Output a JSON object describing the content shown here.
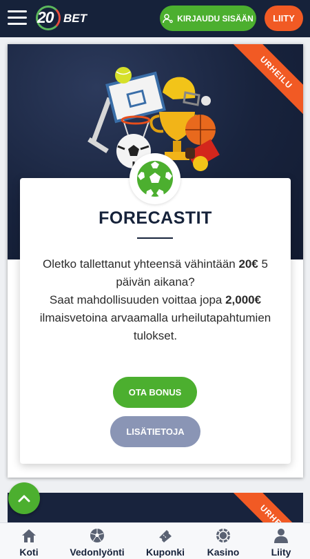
{
  "header": {
    "logo_number": "20",
    "logo_text": "BET",
    "login_label": "KIRJAUDU SISÄÄN",
    "join_label": "LIITY"
  },
  "promo": {
    "ribbon": "URHEILU",
    "title": "FORECASTIT",
    "desc_1": "Oletko tallettanut yhteensä vähintään ",
    "desc_amount": "20€",
    "desc_2": " 5 päivän aikana?",
    "desc_3": "Saat mahdollisuuden voittaa jopa ",
    "desc_prize": "2,000€",
    "desc_4": " ilmaisvetoina arvaamalla urheilutapahtumien tulokset.",
    "bonus_label": "OTA BONUS",
    "info_label": "LISÄTIETOJA"
  },
  "next_card": {
    "ribbon": "URHEILU"
  },
  "nav": {
    "items": [
      {
        "label": "Koti",
        "icon": "home-icon"
      },
      {
        "label": "Vedonlyönti",
        "icon": "soccer-ball-icon"
      },
      {
        "label": "Kuponki",
        "icon": "ticket-icon"
      },
      {
        "label": "Kasino",
        "icon": "casino-chip-icon"
      },
      {
        "label": "Liity",
        "icon": "user-icon"
      }
    ]
  },
  "colors": {
    "navy": "#16223a",
    "green": "#4caf2f",
    "orange": "#f15a24",
    "muted_button": "#8a95b5"
  }
}
